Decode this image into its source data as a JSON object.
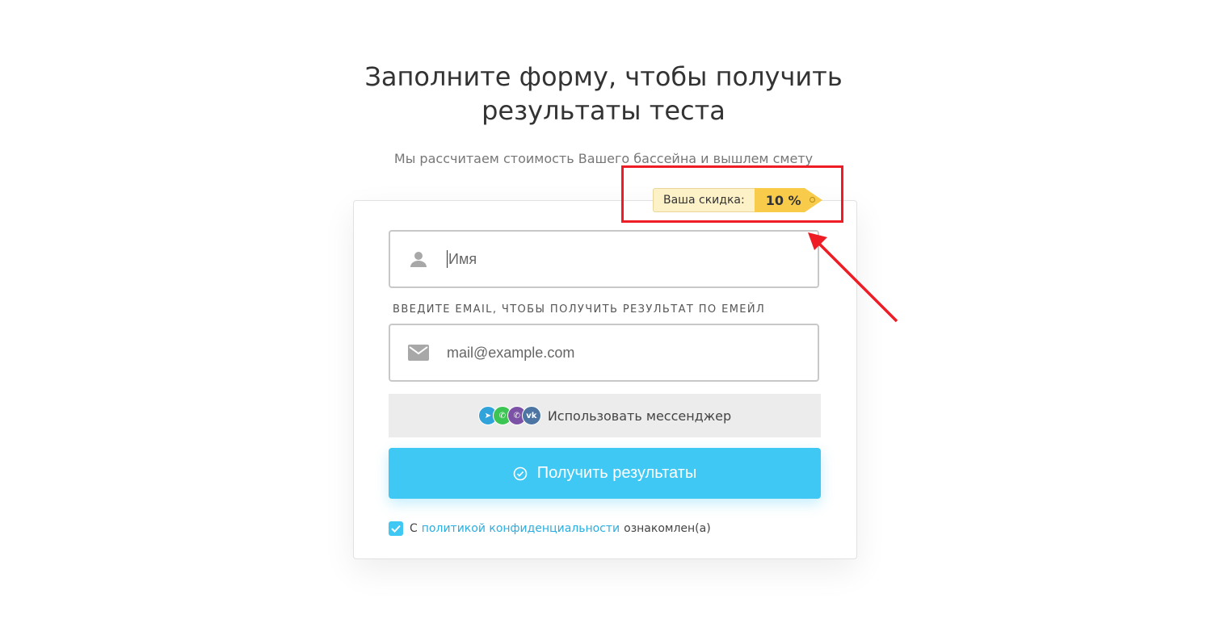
{
  "heading": "Заполните форму, чтобы получить\nрезультаты теста",
  "subheading": "Мы рассчитаем стоимость Вашего бассейна и вышлем смету",
  "discount": {
    "label": "Ваша скидка:",
    "value": "10 %",
    "color": "#f8cc4a"
  },
  "form": {
    "name_placeholder": "Имя",
    "name_icon": "user-icon",
    "email_hint": "ВВЕДИТЕ EMAIL, ЧТОБЫ ПОЛУЧИТЬ РЕЗУЛЬТАТ ПО ЕМЕЙЛ",
    "email_placeholder": "mail@example.com",
    "email_icon": "mail-icon",
    "messenger_label": "Использовать мессенджер",
    "messenger_icons": [
      "telegram-icon",
      "whatsapp-icon",
      "viber-icon",
      "vk-icon"
    ],
    "submit_label": "Получить результаты",
    "submit_color": "#3fc8f4",
    "consent_prefix": "С",
    "consent_link": "политикой конфиденциальности",
    "consent_suffix": "ознакомлен(а)",
    "consent_checked": true
  },
  "annotation": {
    "color": "#ee1c24"
  }
}
